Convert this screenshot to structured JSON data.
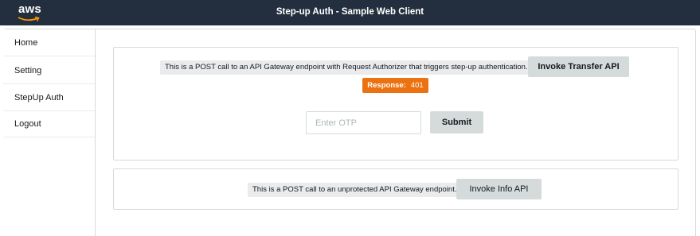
{
  "header": {
    "logo_text": "aws",
    "title": "Step-up Auth - Sample Web Client"
  },
  "sidebar": {
    "items": [
      {
        "label": "Home"
      },
      {
        "label": "Setting"
      },
      {
        "label": "StepUp Auth"
      },
      {
        "label": "Logout"
      }
    ]
  },
  "transfer_card": {
    "description": "This is a POST call to an API Gateway endpoint with Request Authorizer that triggers step-up authentication.",
    "invoke_label": "Invoke Transfer API",
    "response_label": "Response:",
    "response_code": "401",
    "otp_placeholder": "Enter OTP",
    "otp_value": "",
    "submit_label": "Submit"
  },
  "info_card": {
    "description": "This is a POST call to an unprotected API Gateway endpoint.",
    "invoke_label": "Invoke Info API"
  },
  "colors": {
    "header_bg": "#232f3e",
    "accent_orange": "#ec7211",
    "button_gray": "#d5dbdb",
    "label_gray": "#e9ebed"
  }
}
